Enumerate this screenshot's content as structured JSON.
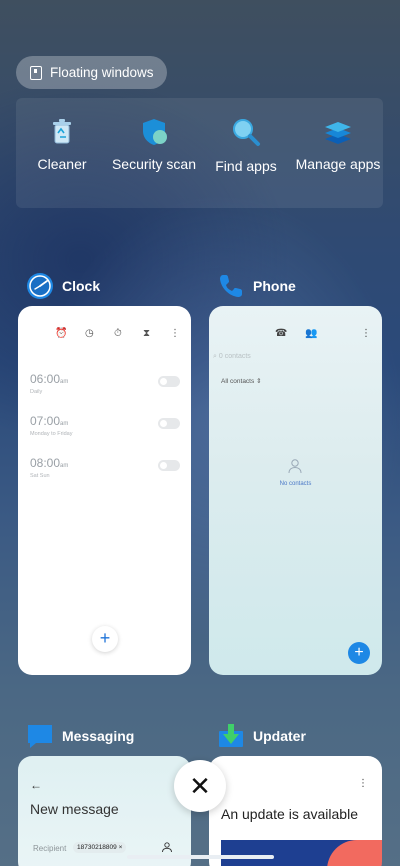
{
  "floating_windows": {
    "label": "Floating windows"
  },
  "shortcuts": [
    {
      "label": "Cleaner",
      "icon": "trash-cleaner-icon"
    },
    {
      "label": "Security scan",
      "icon": "shield-icon"
    },
    {
      "label": "Find apps",
      "icon": "magnifier-icon"
    },
    {
      "label": "Manage apps",
      "icon": "layers-icon"
    }
  ],
  "apps": {
    "clock": {
      "name": "Clock",
      "alarms": [
        {
          "time": "06:00",
          "ampm": "am",
          "repeat": "Daily"
        },
        {
          "time": "07:00",
          "ampm": "am",
          "repeat": "Monday to Friday"
        },
        {
          "time": "08:00",
          "ampm": "am",
          "repeat": "Sat Sun"
        }
      ],
      "add_label": "+"
    },
    "phone": {
      "name": "Phone",
      "search_placeholder": "0 contacts",
      "filter_label": "All contacts",
      "empty_text": "No contacts",
      "add_label": "+"
    },
    "messaging": {
      "name": "Messaging",
      "title": "New message",
      "recipient_label": "Recipient",
      "recipient_value": "18730218809"
    },
    "updater": {
      "name": "Updater",
      "title": "An update is available"
    }
  },
  "close_label": "✕",
  "colors": {
    "accent_blue": "#1e88e5",
    "update_banner_blue": "#1e3f91",
    "update_banner_coral": "#f26a5f"
  }
}
